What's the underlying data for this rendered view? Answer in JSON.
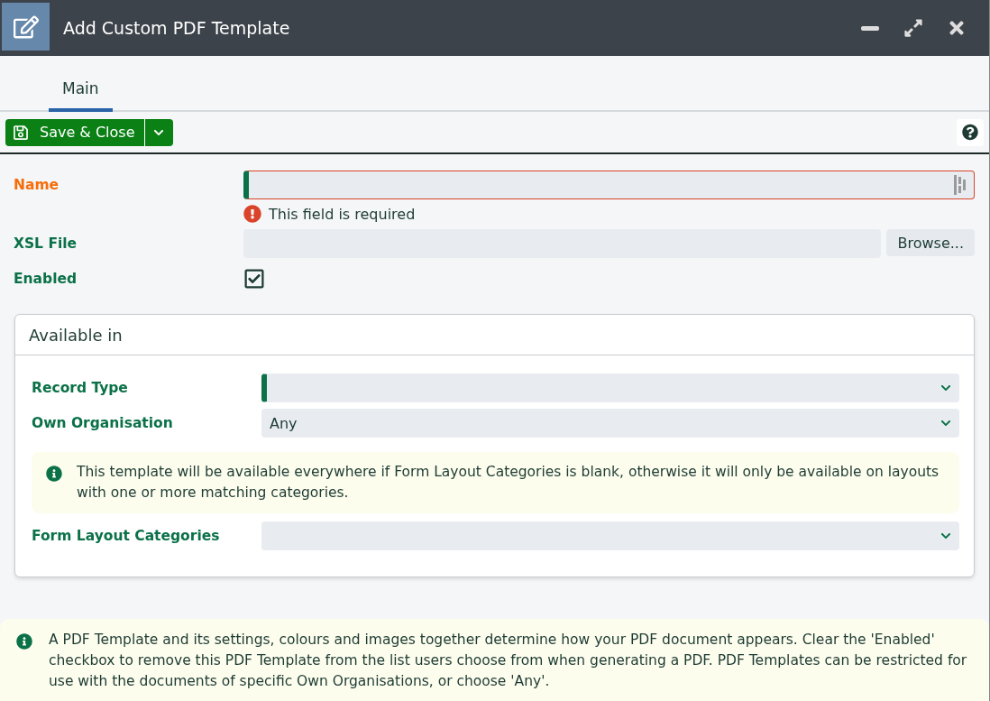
{
  "window": {
    "title": "Add Custom PDF Template"
  },
  "tabs": [
    {
      "label": "Main",
      "selected": true
    }
  ],
  "toolbar": {
    "save_label": "Save & Close"
  },
  "fields": [
    {
      "kind": "text",
      "label": "Name",
      "required": true,
      "error": "This field is required"
    },
    {
      "kind": "file",
      "label": "XSL File",
      "required": false,
      "button": "Browse..."
    },
    {
      "kind": "checkbox",
      "label": "Enabled",
      "checked": true
    }
  ],
  "section": {
    "title": "Available in",
    "fields": [
      {
        "kind": "select",
        "label": "Record Type",
        "required": true
      },
      {
        "kind": "select",
        "label": "Own Organisation",
        "required": false,
        "value": "Any"
      },
      {
        "kind": "note",
        "text": "This template will be available everywhere if Form Layout Categories is blank, otherwise it will only be available on layouts with one or more matching categories."
      },
      {
        "kind": "select",
        "label": "Form Layout Categories",
        "required": false
      }
    ]
  },
  "footer_note": "A PDF Template and its settings, colours and images together determine how your PDF document appears. Clear the 'Enabled' checkbox to remove this PDF Template from the list users choose from when generating a PDF. PDF Templates can be restricted for use with the documents of specific Own Organisations, or choose 'Any'."
}
